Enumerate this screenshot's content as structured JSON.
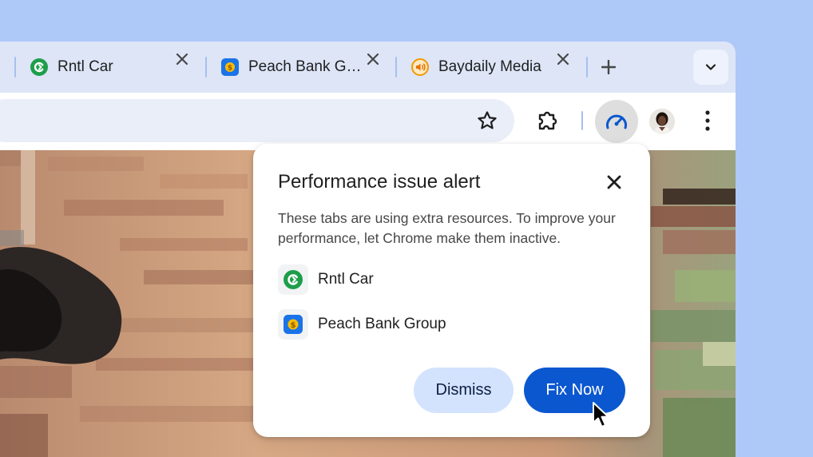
{
  "tabs": [
    {
      "title": "Rntl Car",
      "favicon": "rntl-car-favicon",
      "color": "#1e9e4a"
    },
    {
      "title": "Peach Bank G…",
      "favicon": "peach-bank-favicon",
      "color": "#1a73e8"
    },
    {
      "title": "Baydaily Media",
      "favicon": "baydaily-favicon",
      "color": "#f29900"
    }
  ],
  "tabstrip": {
    "new_tab_icon": "plus-icon",
    "tab_search_icon": "chevron-down-icon"
  },
  "toolbar": {
    "bookmark_icon": "star-icon",
    "extensions_icon": "puzzle-icon",
    "performance_icon": "speedometer-icon",
    "menu_icon": "kebab-menu-icon"
  },
  "popup": {
    "title": "Performance issue alert",
    "body": "These tabs are using extra resources. To improve your performance, let Chrome make them inactive.",
    "items": [
      {
        "label": "Rntl Car"
      },
      {
        "label": "Peach Bank Group"
      }
    ],
    "dismiss_label": "Dismiss",
    "fix_label": "Fix Now"
  },
  "colors": {
    "accent": "#0b57d0",
    "tonal": "#d3e3fd",
    "background": "#aec8f8"
  }
}
